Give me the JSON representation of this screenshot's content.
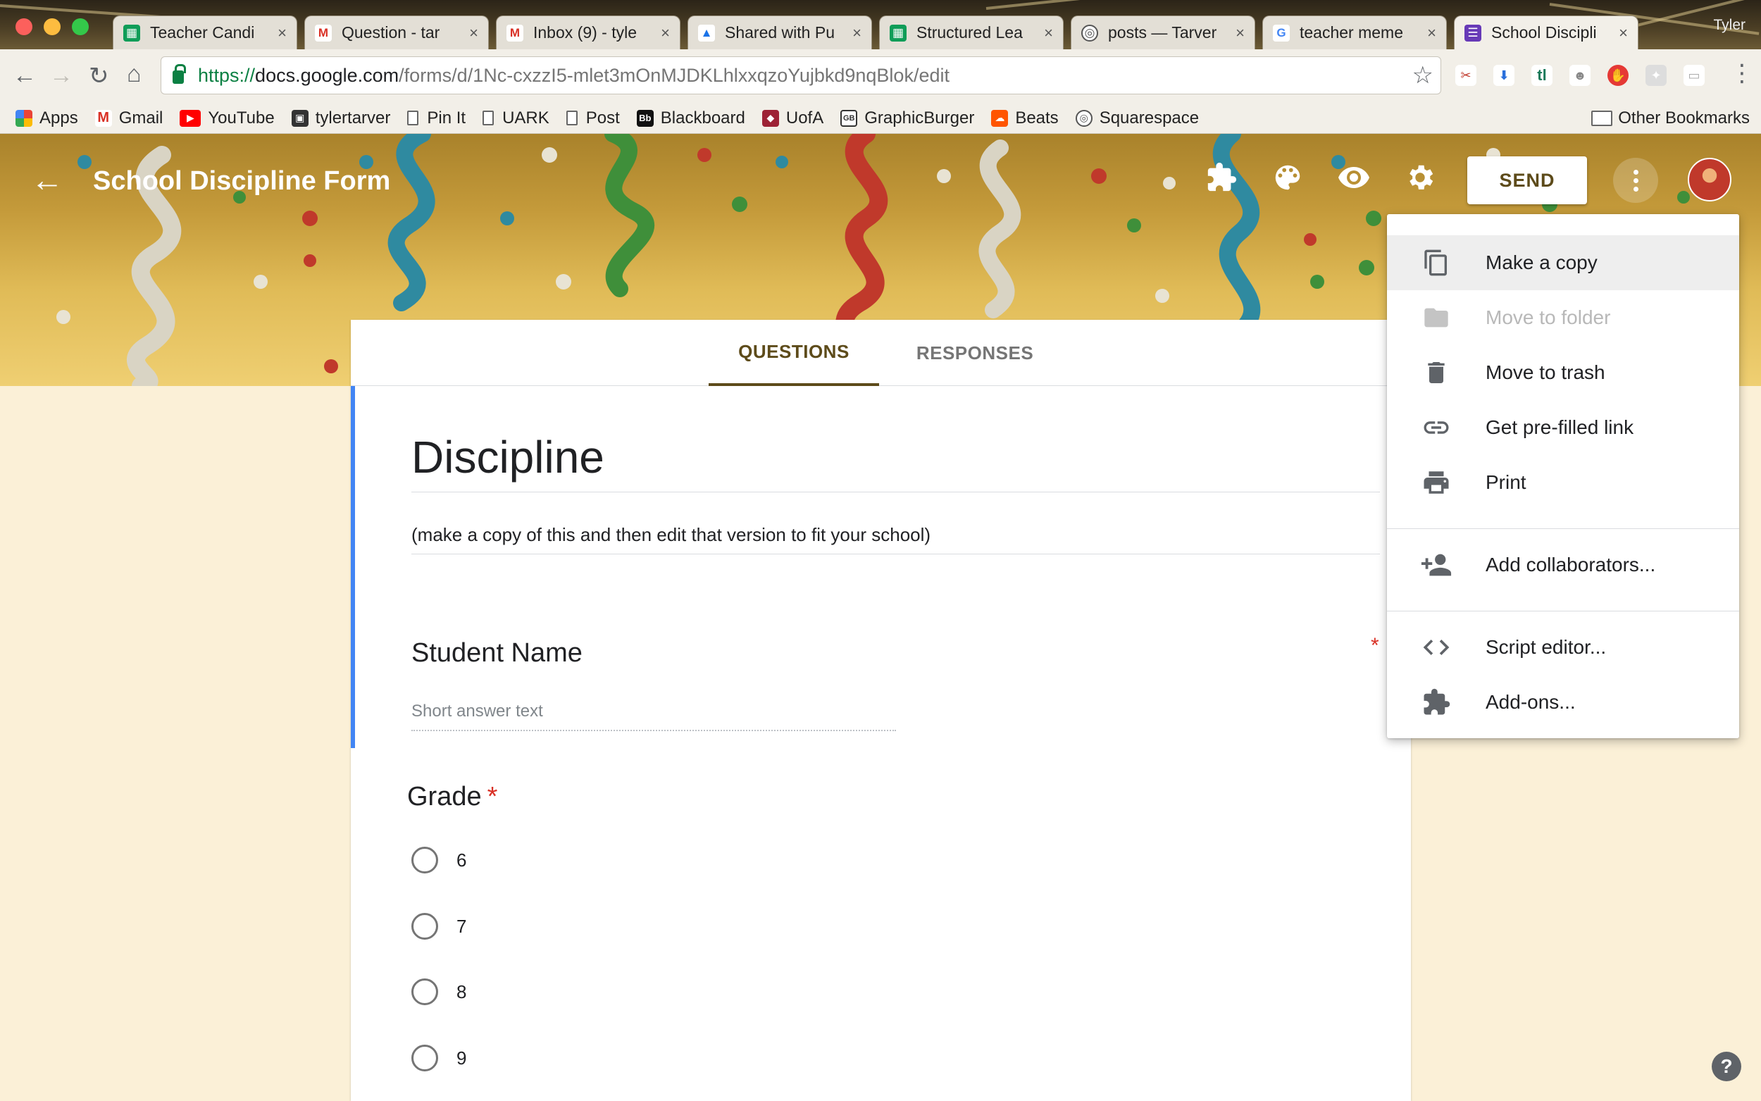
{
  "browser": {
    "tabs": [
      {
        "title": "Teacher Candi",
        "icon": "sheets-icon",
        "color": "#0f9d58"
      },
      {
        "title": "Question - tar",
        "icon": "gmail-icon",
        "color": "#d93025"
      },
      {
        "title": "Inbox (9) - tyle",
        "icon": "gmail-icon",
        "color": "#d93025"
      },
      {
        "title": "Shared with Pu",
        "icon": "drive-icon",
        "color": "#1a73e8"
      },
      {
        "title": "Structured Lea",
        "icon": "sheets-icon",
        "color": "#0f9d58"
      },
      {
        "title": "posts — Tarver",
        "icon": "squarespace-icon",
        "color": "#555555"
      },
      {
        "title": "teacher meme",
        "icon": "google-icon",
        "color": "#4285f4"
      },
      {
        "title": "School Discipli",
        "icon": "forms-icon",
        "color": "#673ab7",
        "active": true
      }
    ],
    "profile_name": "Tyler",
    "url": {
      "scheme": "https://",
      "host": "docs.google.com",
      "path": "/forms/d/1Nc-cxzzI5-mlet3mOnMJDKLhlxxqzoYujbkd9nqBlok/edit"
    },
    "bookmarks": [
      {
        "label": "Apps",
        "icon": "apps-grid-icon",
        "color": "#ea4335"
      },
      {
        "label": "Gmail",
        "icon": "gmail-icon",
        "color": "#d93025"
      },
      {
        "label": "YouTube",
        "icon": "youtube-icon",
        "color": "#ff0000"
      },
      {
        "label": "tylertarver",
        "icon": "site-icon",
        "color": "#333333"
      },
      {
        "label": "Pin It",
        "icon": "page-icon",
        "color": ""
      },
      {
        "label": "UARK",
        "icon": "page-icon",
        "color": ""
      },
      {
        "label": "Post",
        "icon": "page-icon",
        "color": ""
      },
      {
        "label": "Blackboard",
        "icon": "blackboard-icon",
        "color": "#111111"
      },
      {
        "label": "UofA",
        "icon": "razorback-icon",
        "color": "#9d2235"
      },
      {
        "label": "GraphicBurger",
        "icon": "graphicburger-icon",
        "color": "#333333"
      },
      {
        "label": "Beats",
        "icon": "soundcloud-icon",
        "color": "#ff5500"
      },
      {
        "label": "Squarespace",
        "icon": "squarespace-icon",
        "color": "#555555"
      }
    ],
    "other_bookmarks": "Other Bookmarks"
  },
  "header": {
    "form_title": "School Discipline Form",
    "send_label": "SEND",
    "accent": "#5d4b1a"
  },
  "tabs": {
    "questions": "QUESTIONS",
    "responses": "RESPONSES"
  },
  "form": {
    "heading": "Discipline",
    "description": "(make a copy of this and then edit that version to fit your school)",
    "questions": [
      {
        "title": "Student Name",
        "required": "*",
        "answer_placeholder": "Short answer text"
      },
      {
        "title": "Grade",
        "required": "*",
        "options": [
          "6",
          "7",
          "8",
          "9"
        ]
      }
    ]
  },
  "menu": {
    "items": [
      {
        "label": "Make a copy",
        "icon": "copy-icon"
      },
      {
        "label": "Move to folder",
        "icon": "folder-icon"
      },
      {
        "label": "Move to trash",
        "icon": "trash-icon"
      },
      {
        "label": "Get pre-filled link",
        "icon": "link-icon"
      },
      {
        "label": "Print",
        "icon": "print-icon"
      },
      {
        "label": "Add collaborators...",
        "icon": "add-people-icon"
      },
      {
        "label": "Script editor...",
        "icon": "code-icon"
      },
      {
        "label": "Add-ons...",
        "icon": "puzzle-icon"
      }
    ]
  },
  "help_label": "?"
}
